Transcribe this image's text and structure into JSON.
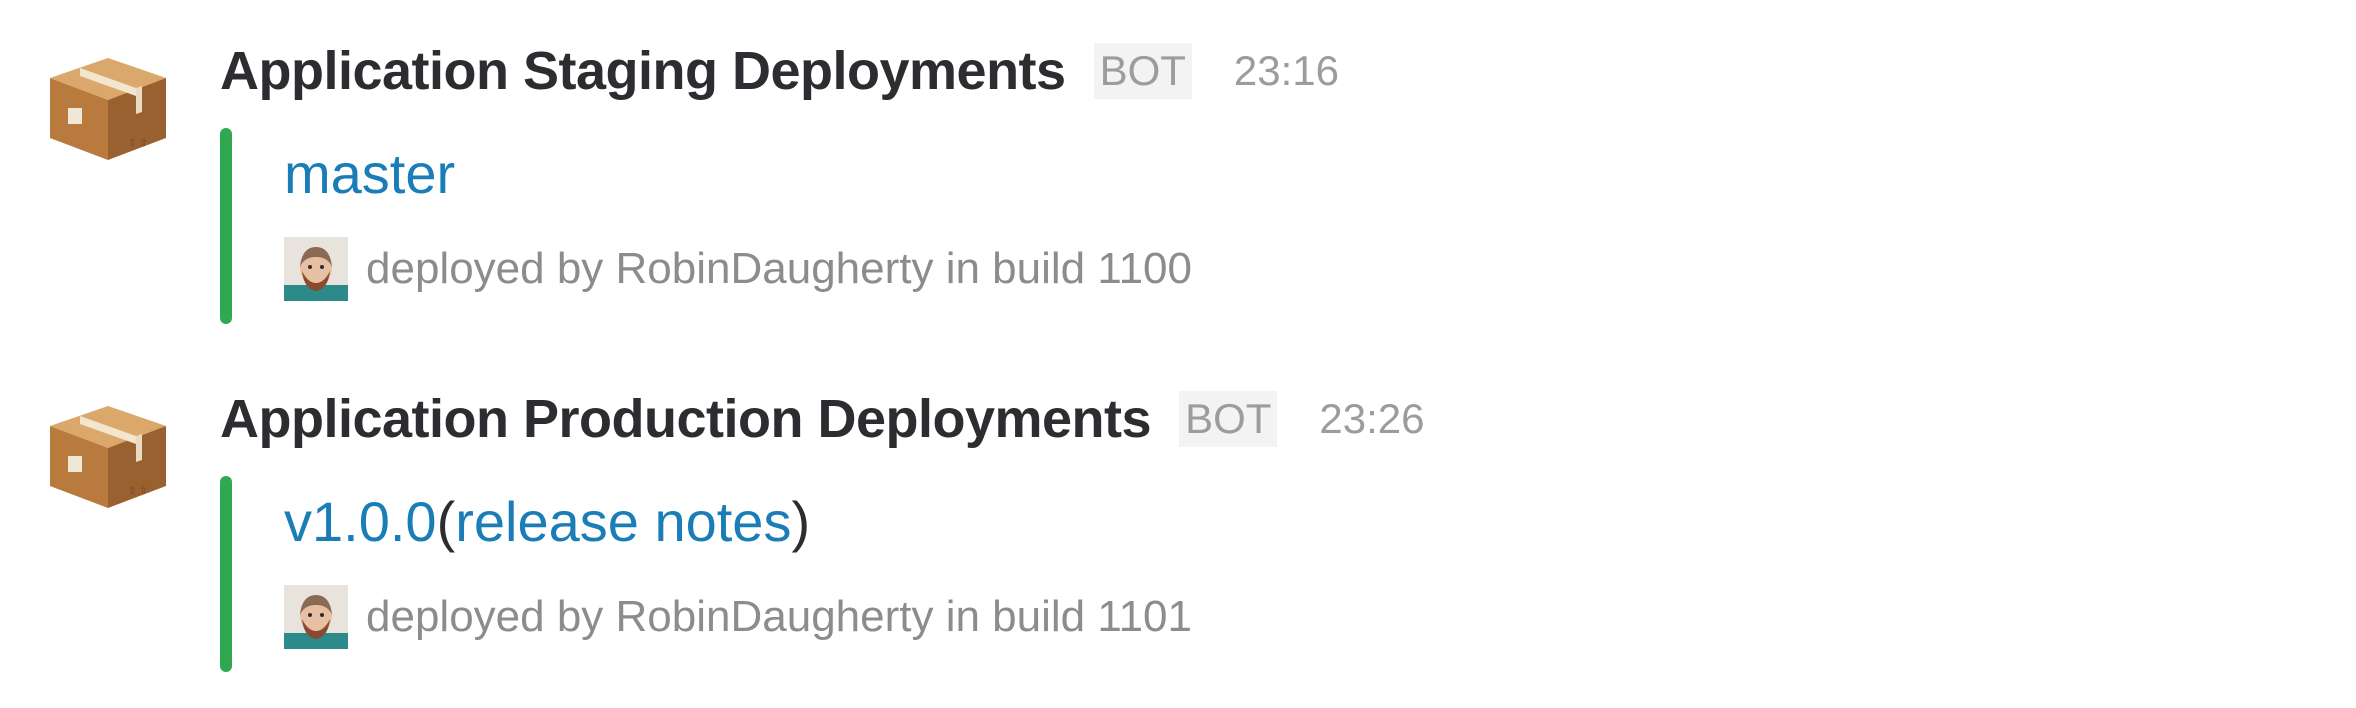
{
  "colors": {
    "attachment_bar": "#2fa84f",
    "link": "#1a7db8",
    "meta_text": "#9c9c9c",
    "sender_text": "#2c2d30"
  },
  "messages": [
    {
      "avatar_icon": "package-box-icon",
      "sender": "Application Staging Deployments",
      "badge": "BOT",
      "time": "23:16",
      "attachment": {
        "title_link": "master",
        "footer_icon": "user-avatar-icon",
        "footer_text": "deployed by RobinDaugherty in build 1100"
      }
    },
    {
      "avatar_icon": "package-box-icon",
      "sender": "Application Production Deployments",
      "badge": "BOT",
      "time": "23:26",
      "attachment": {
        "title_link": "v1.0.0",
        "open_paren": "(",
        "notes_link": "release notes",
        "close_paren": ")",
        "footer_icon": "user-avatar-icon",
        "footer_text": "deployed by RobinDaugherty in build 1101"
      }
    }
  ]
}
